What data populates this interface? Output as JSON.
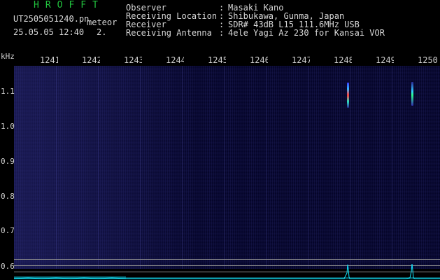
{
  "header": {
    "app_title": "HROFFT",
    "file_name": "UT2505051240.pn",
    "mode_label": "meteor",
    "date_time": "25.05.05 12:40",
    "counter": "2."
  },
  "station_info": [
    {
      "label": "Observer",
      "value": "Masaki Kano"
    },
    {
      "label": "Receiving Location",
      "value": "Shibukawa, Gunma, Japan"
    },
    {
      "label": "Receiver",
      "value": "SDR# 43dB L15 111.6MHz USB"
    },
    {
      "label": "Receiving Antenna",
      "value": "4ele Yagi Az 230 for Kansai VOR"
    }
  ],
  "info_separator": ":",
  "axes": {
    "frequency_unit": "kHz",
    "time_ticks": [
      "1241",
      "1242",
      "1243",
      "1244",
      "1245",
      "1246",
      "1247",
      "1248",
      "1249",
      "1250"
    ],
    "frequency_ticks": [
      "1.1",
      "1.0",
      "0.9",
      "0.8",
      "0.7",
      "0.6"
    ]
  },
  "colors": {
    "title_green": "#21c33e",
    "text": "#d8d8d8",
    "background": "#000000",
    "spectrogram_bg": "#050528",
    "trace": "#12e8ff"
  }
}
